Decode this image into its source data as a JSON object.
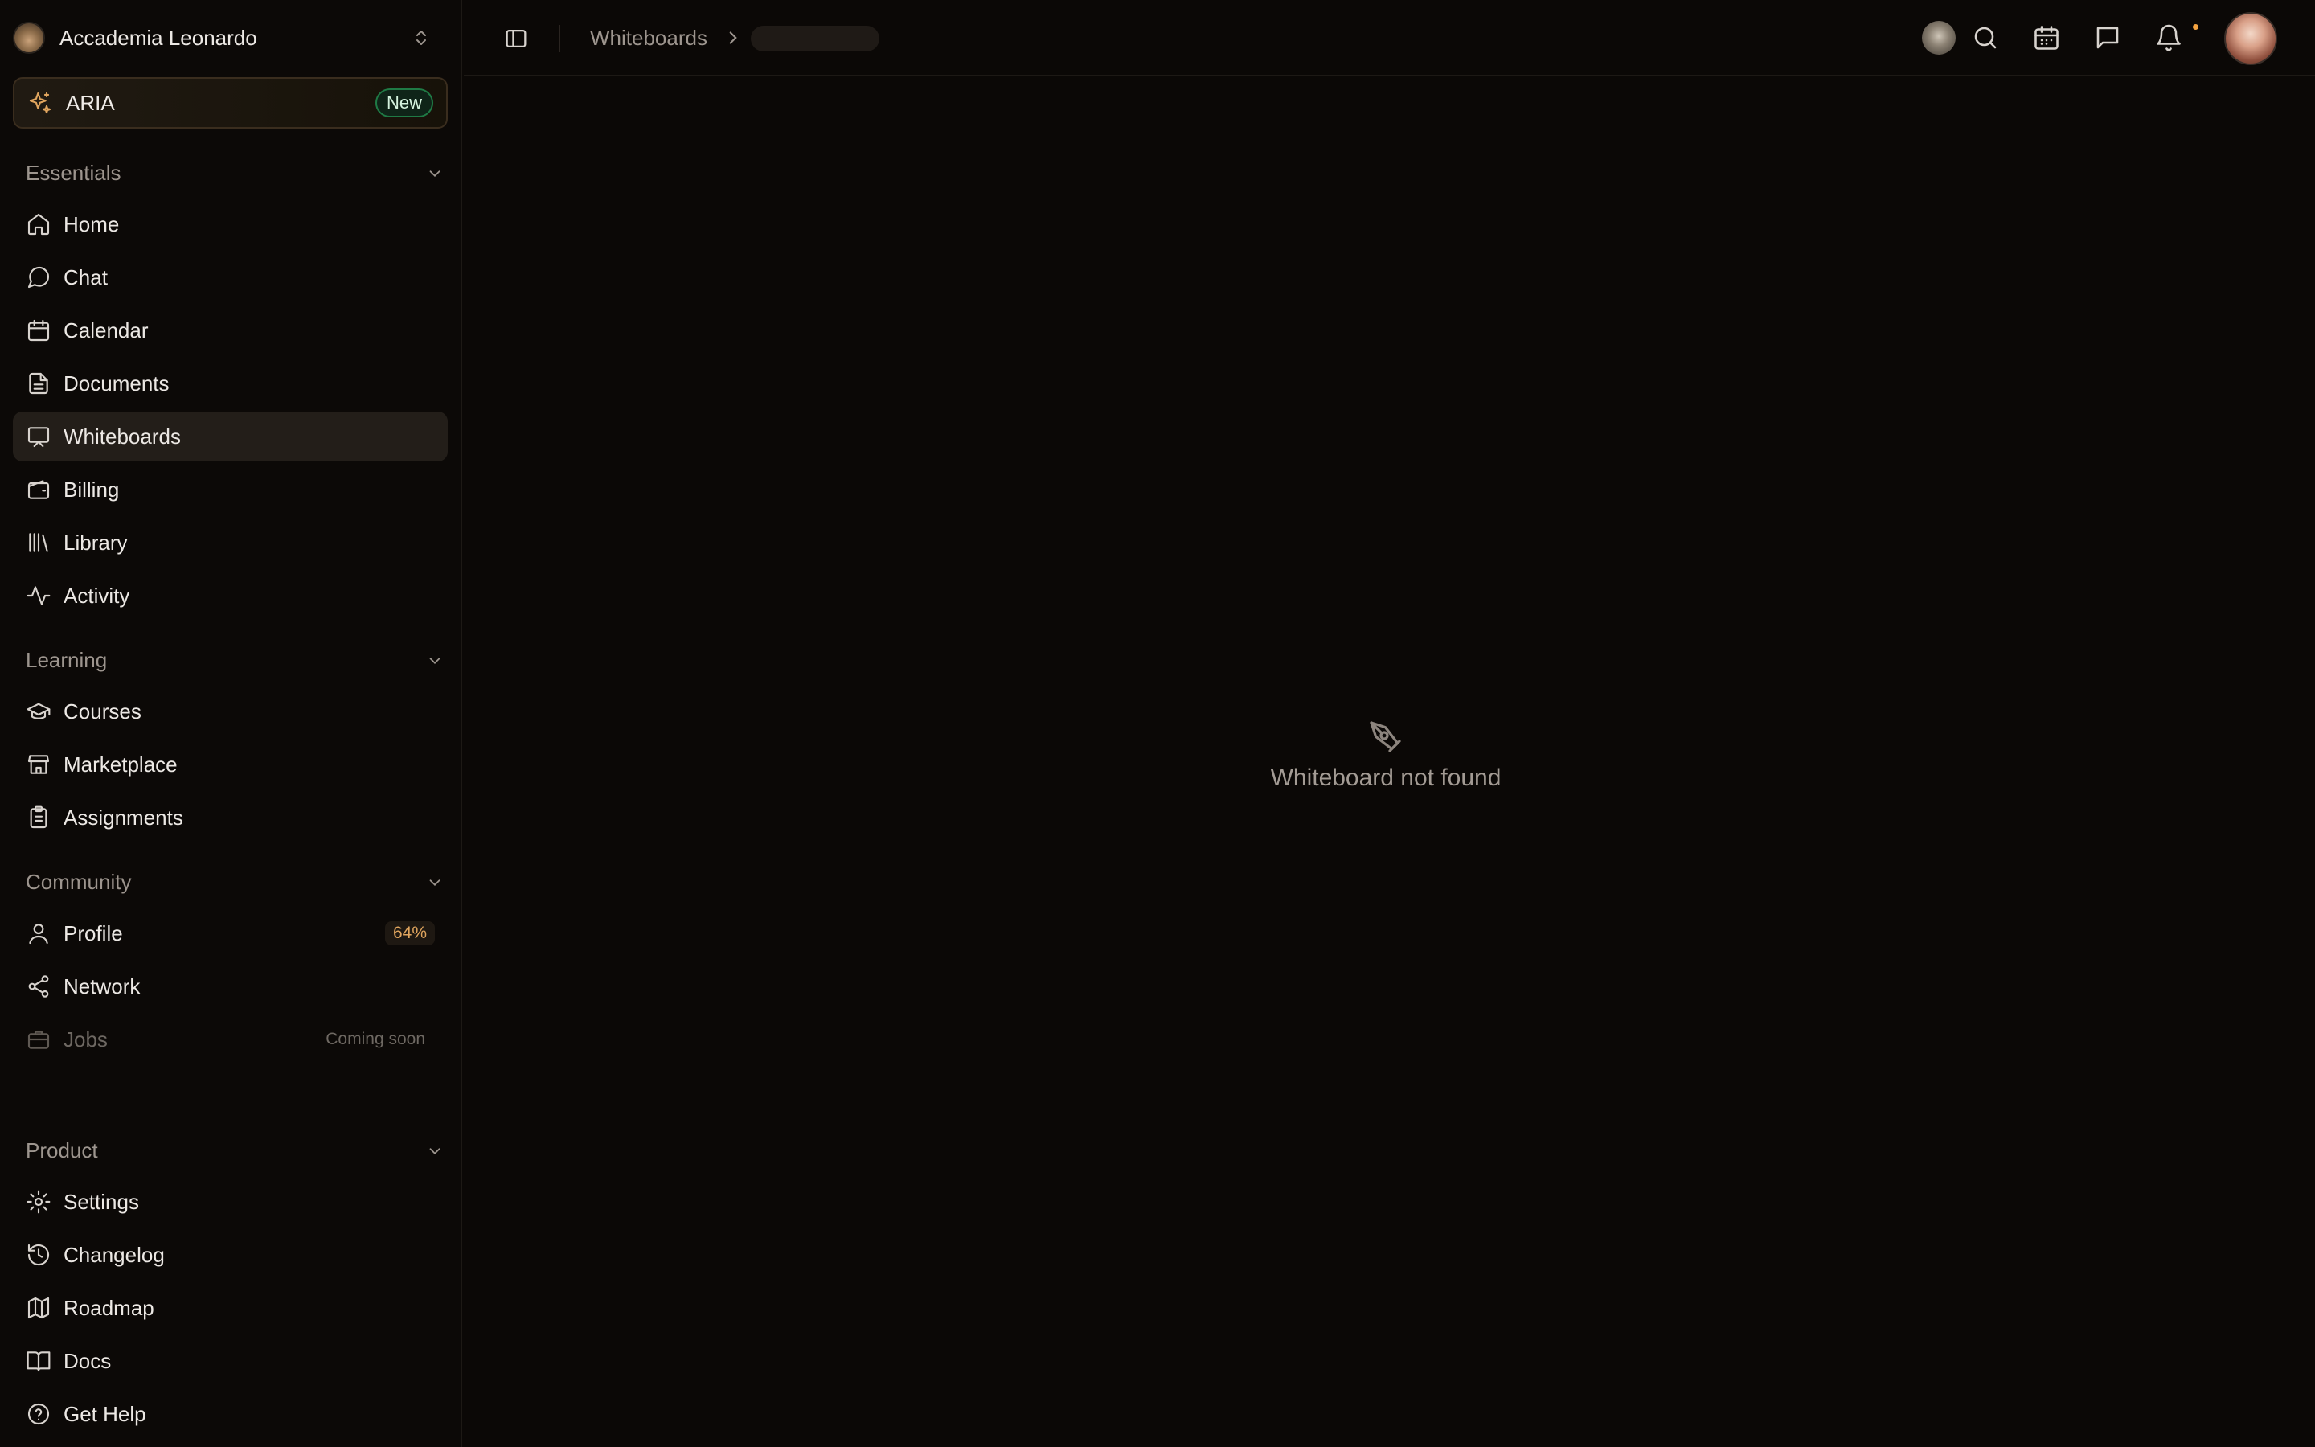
{
  "org": {
    "name": "Accademia Leonardo"
  },
  "aria": {
    "label": "ARIA",
    "badge": "New"
  },
  "sections": {
    "essentials": "Essentials",
    "learning": "Learning",
    "community": "Community",
    "product": "Product"
  },
  "nav": {
    "home": "Home",
    "chat": "Chat",
    "calendar": "Calendar",
    "documents": "Documents",
    "whiteboards": "Whiteboards",
    "billing": "Billing",
    "library": "Library",
    "activity": "Activity",
    "courses": "Courses",
    "marketplace": "Marketplace",
    "assignments": "Assignments",
    "profile": "Profile",
    "profile_completion": "64%",
    "network": "Network",
    "jobs": "Jobs",
    "jobs_status": "Coming soon",
    "settings": "Settings",
    "changelog": "Changelog",
    "roadmap": "Roadmap",
    "docs": "Docs",
    "get_help": "Get Help"
  },
  "active_item": "whiteboards",
  "breadcrumb": {
    "root": "Whiteboards"
  },
  "topbar_icons": [
    "mascot-avatar",
    "search-icon",
    "calendar-icon",
    "chat-icon",
    "bell-icon",
    "user-avatar"
  ],
  "main": {
    "empty_message": "Whiteboard not found"
  },
  "colors": {
    "background": "#0b0806",
    "accent": "#f5a340",
    "new_badge": "#1f7a45",
    "profile_badge_text": "#e0a55e"
  }
}
